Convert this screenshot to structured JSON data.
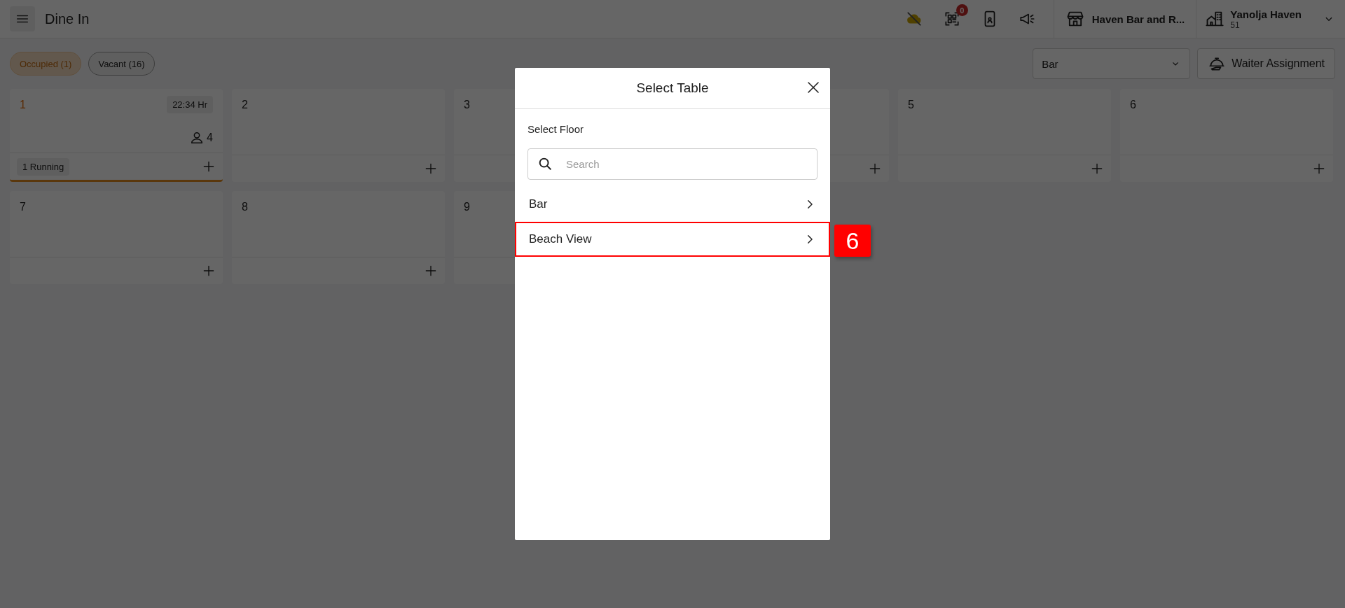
{
  "header": {
    "title": "Dine In",
    "qr_badge": "0",
    "outlet": "Haven Bar and R...",
    "account": {
      "name": "Yanolja Haven",
      "code": "51"
    }
  },
  "filters": [
    {
      "label": "Occupied (1)",
      "selected": true
    },
    {
      "label": "Vacant (16)",
      "selected": false
    }
  ],
  "floor_select": {
    "value": "Bar"
  },
  "waiter_button": "Waiter Assignment",
  "tables": [
    {
      "number": "1",
      "occupied": true,
      "time": "22:34 Hr",
      "guests": "4",
      "orders": "1 Running",
      "add_button": true
    },
    {
      "number": "2",
      "occupied": false,
      "add_button": true
    },
    {
      "number": "3",
      "occupied": false,
      "add_button": false
    },
    {
      "occupied": false,
      "add_button": true
    },
    {
      "number": "5",
      "occupied": false,
      "add_button": true
    },
    {
      "number": "6",
      "occupied": false,
      "add_button": true
    },
    {
      "number": "7",
      "occupied": false,
      "add_button": true
    },
    {
      "number": "8",
      "occupied": false,
      "add_button": true
    },
    {
      "number": "9",
      "occupied": false,
      "add_button": false
    }
  ],
  "dialog": {
    "title": "Select Table",
    "label": "Select Floor",
    "search_placeholder": "Search",
    "floors": [
      {
        "name": "Bar",
        "highlighted": false
      },
      {
        "name": "Beach View",
        "highlighted": true,
        "marker": "6"
      }
    ]
  }
}
